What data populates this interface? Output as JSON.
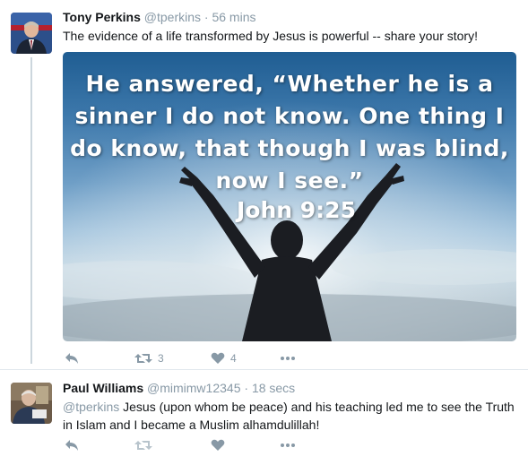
{
  "tweets": [
    {
      "author_name": "Tony Perkins",
      "handle": "@tperkins",
      "separator": "·",
      "time": "56 mins",
      "text": "The evidence of a life transformed by Jesus is powerful -- share your story!",
      "media": {
        "quote_lines": [
          "He answered, “Whether he is a",
          "sinner I do not know. One thing I",
          "do know, that though I was blind,",
          "now I see.”"
        ],
        "citation": "John 9:25"
      },
      "actions": {
        "retweet_count": "3",
        "like_count": "4"
      }
    },
    {
      "author_name": "Paul Williams",
      "handle": "@mimimw12345",
      "separator": "·",
      "time": "18 secs",
      "mention": "@tperkins",
      "text": " Jesus (upon whom be peace) and his teaching led me to see the Truth in Islam and I became a Muslim alhamdulillah!",
      "actions": {
        "retweet_count": "",
        "like_count": ""
      }
    }
  ],
  "icons": {
    "reply": "reply-icon",
    "retweet": "retweet-icon",
    "like": "heart-icon",
    "more": "more-icon"
  },
  "colors": {
    "action_gray": "#8899a6",
    "name_text": "#14171a",
    "thread_line": "#ccd6dd"
  }
}
